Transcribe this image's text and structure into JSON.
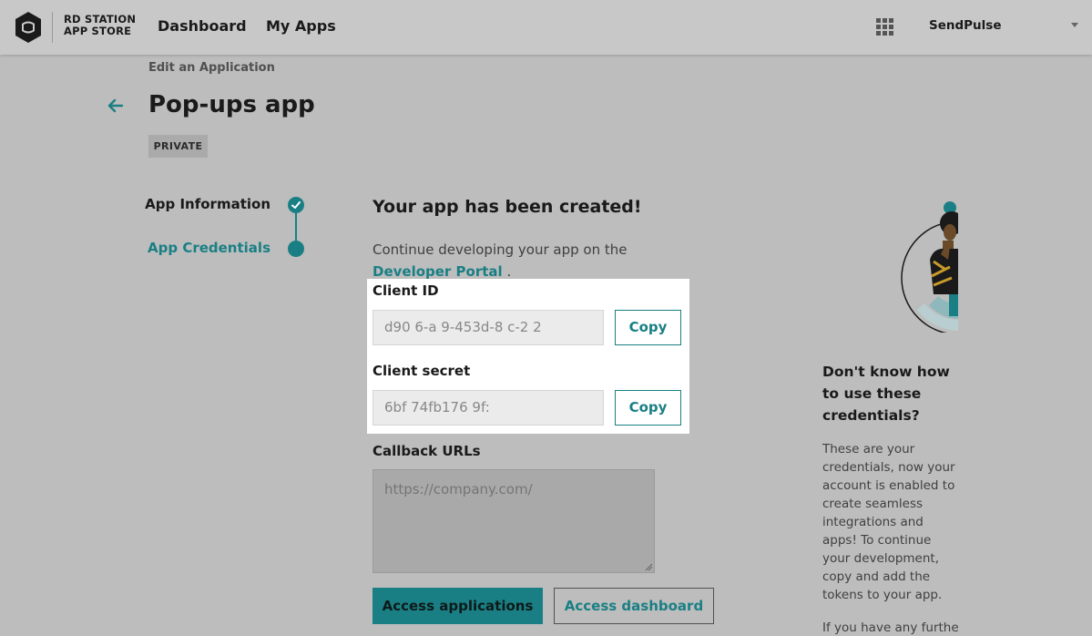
{
  "brand": {
    "line1": "RD STATION",
    "line2": "APP STORE",
    "accent": "#1a7f84"
  },
  "nav": {
    "dashboard": "Dashboard",
    "my_apps": "My Apps"
  },
  "account": {
    "name": "SendPulse"
  },
  "header": {
    "breadcrumb": "Edit an Application",
    "title": "Pop-ups app",
    "badge": "PRIVATE"
  },
  "stepper": {
    "steps": [
      {
        "label": "App Information",
        "state": "completed"
      },
      {
        "label": "App Credentials",
        "state": "current"
      }
    ]
  },
  "main": {
    "title": "Your app has been created!",
    "continue_text": "Continue developing your app on the",
    "portal_link": "Developer Portal",
    "portal_suffix": "."
  },
  "credentials": {
    "client_id": {
      "label": "Client ID",
      "value": "d90      6-a   9-453d-8    c-2    2",
      "copy_label": "Copy"
    },
    "client_secret": {
      "label": "Client secret",
      "value": "6bf              74fb176          9f:",
      "copy_label": "Copy"
    }
  },
  "callback": {
    "label": "Callback URLs",
    "placeholder": "https://company.com/"
  },
  "actions": {
    "primary": "Access applications",
    "secondary": "Access dashboard"
  },
  "help": {
    "title": "Don't know how to use these credentials?",
    "body": "These are your credentials, now your account is enabled to create seamless integrations and apps! To continue your development, copy and add the tokens to your app.",
    "more": "If you have any further"
  }
}
